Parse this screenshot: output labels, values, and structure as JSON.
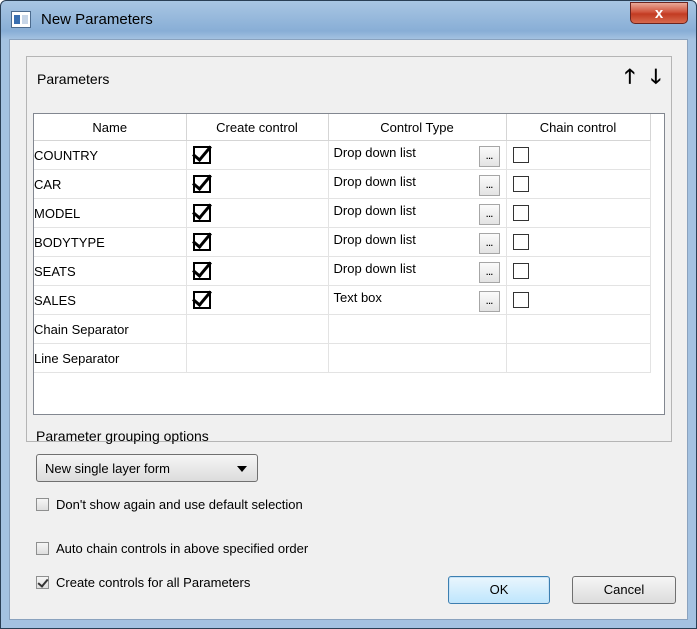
{
  "window": {
    "title": "New Parameters",
    "close_label": "x"
  },
  "parameters_panel": {
    "title": "Parameters",
    "move_up_glyph": "🡑",
    "move_down_glyph": "🡓",
    "columns": [
      "Name",
      "Create control",
      "Control Type",
      "Chain control"
    ],
    "rows": [
      {
        "name": "COUNTRY",
        "create_control": true,
        "control_type": "Drop down list",
        "chain_control": false
      },
      {
        "name": "CAR",
        "create_control": true,
        "control_type": "Drop down list",
        "chain_control": false
      },
      {
        "name": "MODEL",
        "create_control": true,
        "control_type": "Drop down list",
        "chain_control": false
      },
      {
        "name": "BODYTYPE",
        "create_control": true,
        "control_type": "Drop down list",
        "chain_control": false
      },
      {
        "name": "SEATS",
        "create_control": true,
        "control_type": "Drop down list",
        "chain_control": false
      },
      {
        "name": "SALES",
        "create_control": true,
        "control_type": "Text box",
        "chain_control": false
      },
      {
        "name": "Chain Separator",
        "create_control": null,
        "control_type": "",
        "chain_control": null
      },
      {
        "name": "Line Separator",
        "create_control": null,
        "control_type": "",
        "chain_control": null
      }
    ],
    "ellipsis_label": "..."
  },
  "grouping": {
    "label": "Parameter grouping options",
    "selected": "New single layer form"
  },
  "options": {
    "dont_show_again": {
      "label": "Don't show again and use default selection",
      "checked": false
    },
    "auto_chain": {
      "label": "Auto chain controls in above specified order",
      "checked": false
    },
    "create_all": {
      "label": "Create controls for all Parameters",
      "checked": true
    }
  },
  "buttons": {
    "ok": "OK",
    "cancel": "Cancel"
  }
}
